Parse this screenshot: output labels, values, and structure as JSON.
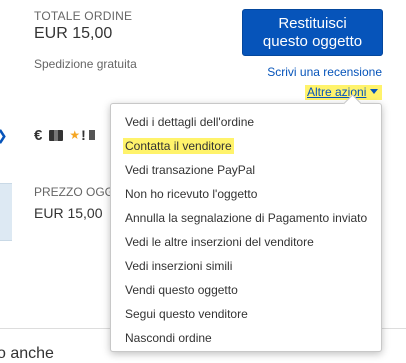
{
  "order": {
    "total_label": "TOTALE ORDINE",
    "total_value": "EUR 15,00",
    "shipping": "Spedizione gratuita"
  },
  "actions": {
    "return_button": [
      "Restituisci",
      "questo oggetto"
    ],
    "review_link": "Scrivi una recensione",
    "more_actions": "Altre azioni"
  },
  "icons": {
    "euro": "€",
    "star": "★",
    "exclaim": "!"
  },
  "price": {
    "label": "PREZZO OGGETTO",
    "value": "EUR 15,00"
  },
  "bottom": {
    "heading": "o anche"
  },
  "menu": {
    "items": [
      "Vedi i dettagli dell'ordine",
      "Contatta il venditore",
      "Vedi transazione PayPal",
      "Non ho ricevuto l'oggetto",
      "Annulla la segnalazione di Pagamento inviato",
      "Vedi le altre inserzioni del venditore",
      "Vedi inserzioni simili",
      "Vendi questo oggetto",
      "Segui questo venditore",
      "Nascondi ordine"
    ],
    "highlighted_index": 1
  },
  "colors": {
    "accent": "#0654ba",
    "highlight": "#fff36b"
  }
}
